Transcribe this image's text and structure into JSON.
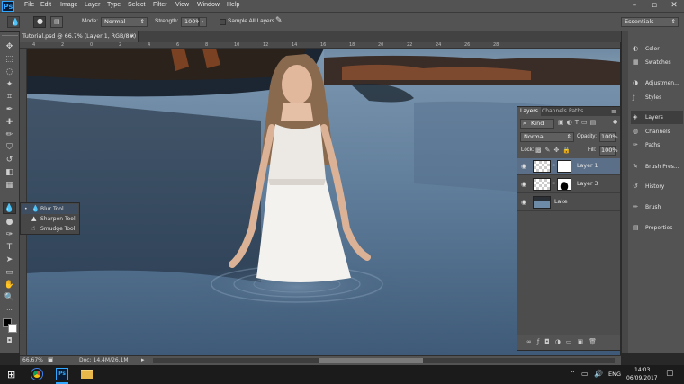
{
  "menubar": {
    "logo": "Ps",
    "items": [
      "File",
      "Edit",
      "Image",
      "Layer",
      "Type",
      "Select",
      "Filter",
      "View",
      "Window",
      "Help"
    ],
    "window_buttons": [
      "–",
      "▫",
      "✕"
    ]
  },
  "options": {
    "mode_label": "Mode:",
    "mode_value": "Normal",
    "strength_label": "Strength:",
    "strength_value": "100%",
    "sample_all": "Sample All Layers",
    "workspace": "Essentials"
  },
  "document": {
    "tab": "Tutorial.psd @ 66.7% (Layer 1, RGB/8#) *",
    "tab_close": "×",
    "ruler_ticks": [
      "4",
      "2",
      "0",
      "2",
      "4",
      "6",
      "8",
      "10",
      "12",
      "14",
      "16",
      "18",
      "20",
      "22",
      "24",
      "26",
      "28"
    ]
  },
  "flyout": {
    "items": [
      "Blur Tool",
      "Sharpen Tool",
      "Smudge Tool"
    ]
  },
  "layers_panel": {
    "tabs": [
      "Layers",
      "Channels",
      "Paths"
    ],
    "kind": "Kind",
    "blend_mode": "Normal",
    "opacity_label": "Opacity:",
    "opacity": "100%",
    "lock_label": "Lock:",
    "fill_label": "Fill:",
    "fill": "100%",
    "layers": [
      {
        "name": "Layer 1"
      },
      {
        "name": "Layer 3"
      },
      {
        "name": "Lake"
      }
    ]
  },
  "dock": {
    "items": [
      "Color",
      "Swatches",
      "Adjustmen...",
      "Styles",
      "Layers",
      "Channels",
      "Paths",
      "Brush Pres...",
      "History",
      "Brush",
      "Properties"
    ]
  },
  "status": {
    "zoom": "66.67%",
    "doc": "Doc: 14.4M/26.1M"
  },
  "taskbar": {
    "language": "ENG",
    "time": "14:03",
    "date": "06/09/2017"
  },
  "colors": {
    "accent": "#31a8ff",
    "panel": "#535353",
    "selected_layer": "#5b6f88"
  }
}
